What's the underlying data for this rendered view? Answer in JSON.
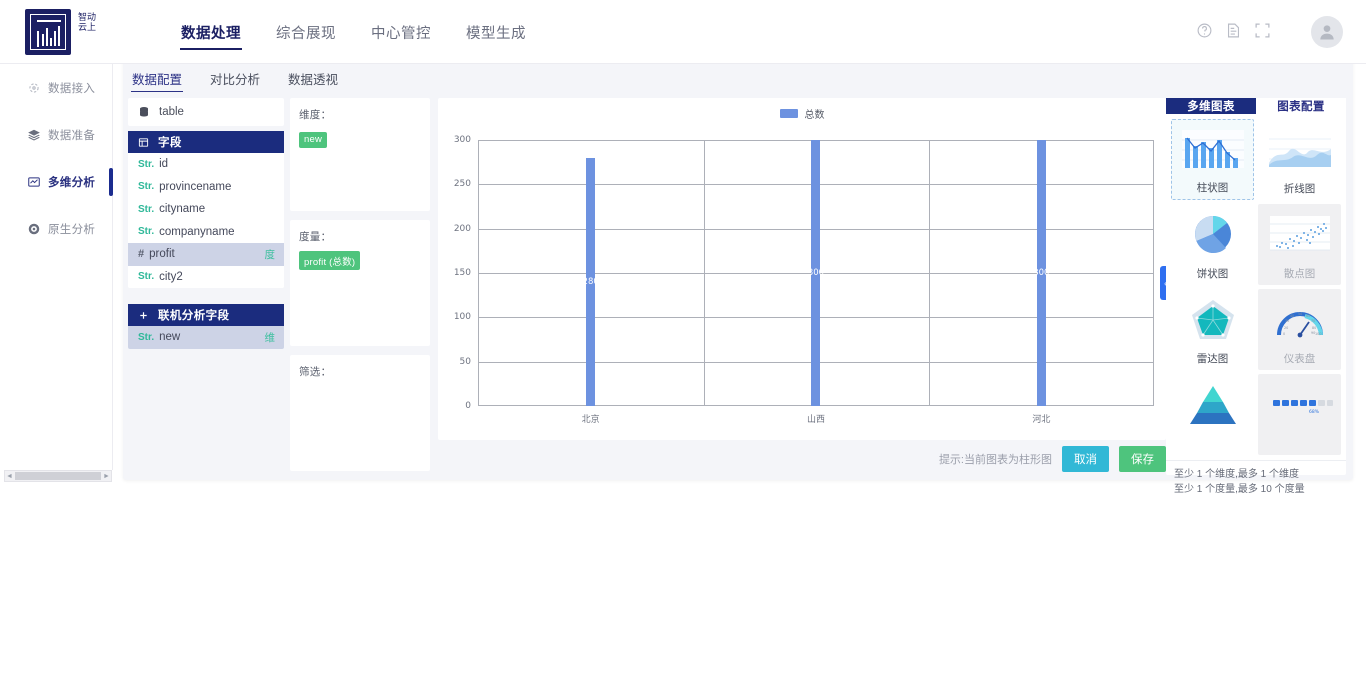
{
  "brand": {
    "logo_text": "智动云上",
    "accent": "#1b2c7e"
  },
  "topnav": {
    "items": [
      {
        "label": "数据处理",
        "active": true
      },
      {
        "label": "综合展现",
        "active": false
      },
      {
        "label": "中心管控",
        "active": false
      },
      {
        "label": "模型生成",
        "active": false
      }
    ],
    "icons": [
      "help-icon",
      "report-icon",
      "fullscreen-icon"
    ]
  },
  "sidebar": {
    "items": [
      {
        "label": "数据接入",
        "icon": "data-access-icon",
        "active": false
      },
      {
        "label": "数据准备",
        "icon": "data-prep-icon",
        "active": false
      },
      {
        "label": "多维分析",
        "icon": "multidim-icon",
        "active": true
      },
      {
        "label": "原生分析",
        "icon": "native-analysis-icon",
        "active": false
      }
    ]
  },
  "subtabs": [
    {
      "label": "数据配置",
      "active": true
    },
    {
      "label": "对比分析",
      "active": false
    },
    {
      "label": "数据透视",
      "active": false
    }
  ],
  "fields_panel": {
    "table_name": "table",
    "section_title": "字段",
    "fields": [
      {
        "type": "Str.",
        "name": "id",
        "badge": "",
        "selected": false
      },
      {
        "type": "Str.",
        "name": "provincename",
        "badge": "",
        "selected": false
      },
      {
        "type": "Str.",
        "name": "cityname",
        "badge": "",
        "selected": false
      },
      {
        "type": "Str.",
        "name": "companyname",
        "badge": "",
        "selected": false
      },
      {
        "type": "#",
        "name": "profit",
        "badge": "度",
        "selected": true
      },
      {
        "type": "Str.",
        "name": "city2",
        "badge": "",
        "selected": false
      }
    ],
    "online_section_title": "联机分析字段",
    "online_fields": [
      {
        "type": "Str.",
        "name": "new",
        "badge": "维",
        "selected": true
      }
    ]
  },
  "shelves": {
    "dimension": {
      "label": "维度：",
      "chips": [
        "new"
      ]
    },
    "measure": {
      "label": "度量：",
      "chips": [
        "profit (总数)"
      ]
    },
    "filter": {
      "label": "筛选：",
      "chips": []
    }
  },
  "chart_data": {
    "type": "bar",
    "title": "",
    "categories": [
      "北京",
      "山西",
      "河北"
    ],
    "series": [
      {
        "name": "总数",
        "values": [
          280,
          300,
          300
        ]
      }
    ],
    "data_labels": [
      "280",
      "300",
      "300"
    ],
    "legend": {
      "entries": [
        "总数"
      ],
      "position": "top-center"
    },
    "xlabel": "",
    "ylabel": "",
    "yticks": [
      0,
      50,
      100,
      150,
      200,
      250,
      300
    ],
    "ylim": [
      0,
      300
    ],
    "grid": true,
    "bar_color": "#6d92e0"
  },
  "bottombar": {
    "hint": "提示:当前图表为柱形图",
    "cancel_label": "取消",
    "save_label": "保存"
  },
  "rightpanel": {
    "tabs": [
      {
        "label": "多维图表",
        "active": true
      },
      {
        "label": "图表配置",
        "active": false
      }
    ],
    "chart_types": [
      {
        "label": "柱状图",
        "icon": "bar-chart-icon",
        "selected": true,
        "disabled": false
      },
      {
        "label": "折线图",
        "icon": "line-chart-icon",
        "selected": false,
        "disabled": false
      },
      {
        "label": "饼状图",
        "icon": "pie-chart-icon",
        "selected": false,
        "disabled": false
      },
      {
        "label": "散点图",
        "icon": "scatter-chart-icon",
        "selected": false,
        "disabled": true
      },
      {
        "label": "雷达图",
        "icon": "radar-chart-icon",
        "selected": false,
        "disabled": false
      },
      {
        "label": "仪表盘",
        "icon": "gauge-chart-icon",
        "selected": false,
        "disabled": true
      },
      {
        "label": "",
        "icon": "funnel-chart-icon",
        "selected": false,
        "disabled": false
      },
      {
        "label": "",
        "icon": "progress-chart-icon",
        "selected": false,
        "disabled": true
      }
    ],
    "notes": [
      "至少 1 个维度,最多 1 个维度",
      "至少 1 个度量,最多 10 个度量"
    ]
  },
  "collapse_handle": {
    "label": "‹"
  }
}
